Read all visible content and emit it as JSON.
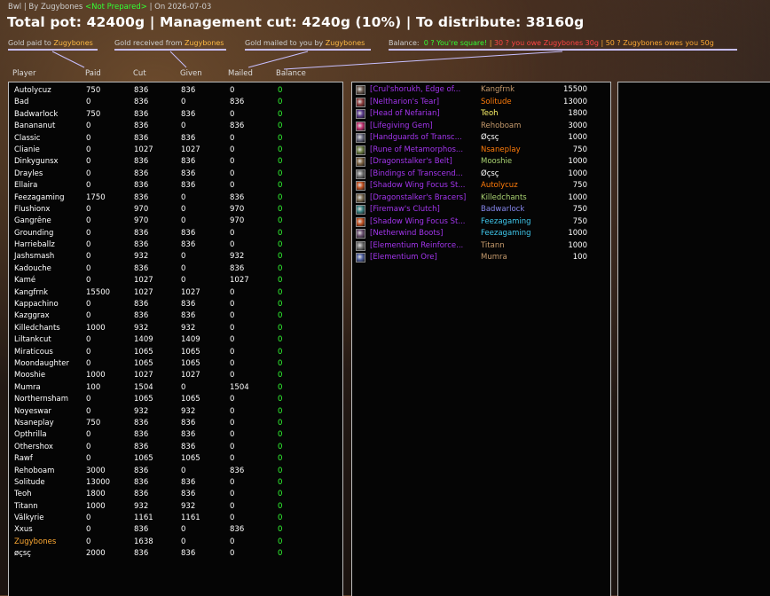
{
  "header": {
    "raid": "Bwl",
    "by": "| By Zugybones",
    "status": "<Not Prepared>",
    "date": "| On 2026-07-03",
    "title": "Total pot: 42400g | Management cut: 4240g (10%) | To distribute: 38160g"
  },
  "legend": {
    "paid_prefix": "Gold paid to",
    "received_prefix": "Gold received from",
    "mailed_prefix": "Gold mailed to you by",
    "name": "Zugybones",
    "balance_label": "Balance:",
    "square": "0 ? You're square!",
    "sep": "|",
    "owe": "30 ? you owe Zugybones 30g",
    "owes": "50 ? Zugybones owes you 50g"
  },
  "columns": [
    "Player",
    "Paid",
    "Cut",
    "Given",
    "Mailed",
    "Balance"
  ],
  "players": [
    {
      "name": "Autolycuz",
      "paid": "750",
      "cut": "836",
      "given": "836",
      "mailed": "0",
      "balance": "0"
    },
    {
      "name": "Bad",
      "paid": "0",
      "cut": "836",
      "given": "0",
      "mailed": "836",
      "balance": "0"
    },
    {
      "name": "Badwarlock",
      "paid": "750",
      "cut": "836",
      "given": "836",
      "mailed": "0",
      "balance": "0"
    },
    {
      "name": "Banananut",
      "paid": "0",
      "cut": "836",
      "given": "0",
      "mailed": "836",
      "balance": "0"
    },
    {
      "name": "Classic",
      "paid": "0",
      "cut": "836",
      "given": "836",
      "mailed": "0",
      "balance": "0"
    },
    {
      "name": "Clianie",
      "paid": "0",
      "cut": "1027",
      "given": "1027",
      "mailed": "0",
      "balance": "0"
    },
    {
      "name": "Dinkygunsx",
      "paid": "0",
      "cut": "836",
      "given": "836",
      "mailed": "0",
      "balance": "0"
    },
    {
      "name": "Drayles",
      "paid": "0",
      "cut": "836",
      "given": "836",
      "mailed": "0",
      "balance": "0"
    },
    {
      "name": "Ellaira",
      "paid": "0",
      "cut": "836",
      "given": "836",
      "mailed": "0",
      "balance": "0"
    },
    {
      "name": "Feezagaming",
      "paid": "1750",
      "cut": "836",
      "given": "0",
      "mailed": "836",
      "balance": "0"
    },
    {
      "name": "Flushionx",
      "paid": "0",
      "cut": "970",
      "given": "0",
      "mailed": "970",
      "balance": "0"
    },
    {
      "name": "Gangrêne",
      "paid": "0",
      "cut": "970",
      "given": "0",
      "mailed": "970",
      "balance": "0"
    },
    {
      "name": "Grounding",
      "paid": "0",
      "cut": "836",
      "given": "836",
      "mailed": "0",
      "balance": "0"
    },
    {
      "name": "Harrieballz",
      "paid": "0",
      "cut": "836",
      "given": "836",
      "mailed": "0",
      "balance": "0"
    },
    {
      "name": "Jashsmash",
      "paid": "0",
      "cut": "932",
      "given": "0",
      "mailed": "932",
      "balance": "0"
    },
    {
      "name": "Kadouche",
      "paid": "0",
      "cut": "836",
      "given": "0",
      "mailed": "836",
      "balance": "0"
    },
    {
      "name": "Kamé",
      "paid": "0",
      "cut": "1027",
      "given": "0",
      "mailed": "1027",
      "balance": "0"
    },
    {
      "name": "Kangfrnk",
      "paid": "15500",
      "cut": "1027",
      "given": "1027",
      "mailed": "0",
      "balance": "0"
    },
    {
      "name": "Kappachino",
      "paid": "0",
      "cut": "836",
      "given": "836",
      "mailed": "0",
      "balance": "0"
    },
    {
      "name": "Kazggrax",
      "paid": "0",
      "cut": "836",
      "given": "836",
      "mailed": "0",
      "balance": "0"
    },
    {
      "name": "Killedchants",
      "paid": "1000",
      "cut": "932",
      "given": "932",
      "mailed": "0",
      "balance": "0"
    },
    {
      "name": "Liltankcut",
      "paid": "0",
      "cut": "1409",
      "given": "1409",
      "mailed": "0",
      "balance": "0"
    },
    {
      "name": "Miraticous",
      "paid": "0",
      "cut": "1065",
      "given": "1065",
      "mailed": "0",
      "balance": "0"
    },
    {
      "name": "Moondaughter",
      "paid": "0",
      "cut": "1065",
      "given": "1065",
      "mailed": "0",
      "balance": "0"
    },
    {
      "name": "Mooshie",
      "paid": "1000",
      "cut": "1027",
      "given": "1027",
      "mailed": "0",
      "balance": "0"
    },
    {
      "name": "Mumra",
      "paid": "100",
      "cut": "1504",
      "given": "0",
      "mailed": "1504",
      "balance": "0"
    },
    {
      "name": "Northernsham",
      "paid": "0",
      "cut": "1065",
      "given": "1065",
      "mailed": "0",
      "balance": "0"
    },
    {
      "name": "Noyeswar",
      "paid": "0",
      "cut": "932",
      "given": "932",
      "mailed": "0",
      "balance": "0"
    },
    {
      "name": "Nsaneplay",
      "paid": "750",
      "cut": "836",
      "given": "836",
      "mailed": "0",
      "balance": "0"
    },
    {
      "name": "Opthrilla",
      "paid": "0",
      "cut": "836",
      "given": "836",
      "mailed": "0",
      "balance": "0"
    },
    {
      "name": "Othershox",
      "paid": "0",
      "cut": "836",
      "given": "836",
      "mailed": "0",
      "balance": "0"
    },
    {
      "name": "Rawf",
      "paid": "0",
      "cut": "1065",
      "given": "1065",
      "mailed": "0",
      "balance": "0"
    },
    {
      "name": "Rehoboam",
      "paid": "3000",
      "cut": "836",
      "given": "0",
      "mailed": "836",
      "balance": "0"
    },
    {
      "name": "Solitude",
      "paid": "13000",
      "cut": "836",
      "given": "836",
      "mailed": "0",
      "balance": "0"
    },
    {
      "name": "Teoh",
      "paid": "1800",
      "cut": "836",
      "given": "836",
      "mailed": "0",
      "balance": "0"
    },
    {
      "name": "Titann",
      "paid": "1000",
      "cut": "932",
      "given": "932",
      "mailed": "0",
      "balance": "0"
    },
    {
      "name": "Välkyrie",
      "paid": "0",
      "cut": "1161",
      "given": "1161",
      "mailed": "0",
      "balance": "0"
    },
    {
      "name": "Xxus",
      "paid": "0",
      "cut": "836",
      "given": "0",
      "mailed": "836",
      "balance": "0"
    },
    {
      "name": "Zugybones",
      "paid": "0",
      "cut": "1638",
      "given": "0",
      "mailed": "0",
      "balance": "0",
      "color": "#ffaa33"
    },
    {
      "name": "øçsç",
      "paid": "2000",
      "cut": "836",
      "given": "836",
      "mailed": "0",
      "balance": "0"
    }
  ],
  "items": [
    {
      "item": "[Crul'shorukh, Edge of...",
      "winner": "Kangfrnk",
      "amount": "15500",
      "winner_color": "#c69b6d",
      "icon": "axe-icon",
      "icon_color": "#6a5a50"
    },
    {
      "item": "[Neltharion's Tear]",
      "winner": "Solitude",
      "amount": "13000",
      "winner_color": "#ff7c0a",
      "icon": "gem-icon",
      "icon_color": "#8a3a3a"
    },
    {
      "item": "[Head of Nefarian]",
      "winner": "Teoh",
      "amount": "1800",
      "winner_color": "#fff468",
      "icon": "head-icon",
      "icon_color": "#5a3a8a"
    },
    {
      "item": "[Lifegiving Gem]",
      "winner": "Rehoboam",
      "amount": "3000",
      "winner_color": "#c69b6d",
      "icon": "orb-icon",
      "icon_color": "#c03070"
    },
    {
      "item": "[Handguards of Transc...",
      "winner": "Øçsç",
      "amount": "1000",
      "winner_color": "#ffffff",
      "icon": "gloves-icon",
      "icon_color": "#6a6a80"
    },
    {
      "item": "[Rune of Metamorphos...",
      "winner": "Nsaneplay",
      "amount": "750",
      "winner_color": "#ff7c0a",
      "icon": "rune-icon",
      "icon_color": "#6a7a40"
    },
    {
      "item": "[Dragonstalker's Belt]",
      "winner": "Mooshie",
      "amount": "1000",
      "winner_color": "#aad372",
      "icon": "belt-icon",
      "icon_color": "#7a6040"
    },
    {
      "item": "[Bindings of Transcend...",
      "winner": "Øçsç",
      "amount": "1000",
      "winner_color": "#ffffff",
      "icon": "bracers-icon",
      "icon_color": "#707070"
    },
    {
      "item": "[Shadow Wing Focus St...",
      "winner": "Autolycuz",
      "amount": "750",
      "winner_color": "#ff7c0a",
      "icon": "staff-icon",
      "icon_color": "#c05020"
    },
    {
      "item": "[Dragonstalker's Bracers]",
      "winner": "Killedchants",
      "amount": "1000",
      "winner_color": "#aad372",
      "icon": "bracers-icon",
      "icon_color": "#7a6a50"
    },
    {
      "item": "[Firemaw's Clutch]",
      "winner": "Badwarlock",
      "amount": "750",
      "winner_color": "#8788ee",
      "icon": "belt-icon",
      "icon_color": "#3a8080"
    },
    {
      "item": "[Shadow Wing Focus St...",
      "winner": "Feezagaming",
      "amount": "750",
      "winner_color": "#3fc7eb",
      "icon": "staff-icon",
      "icon_color": "#c05020"
    },
    {
      "item": "[Netherwind Boots]",
      "winner": "Feezagaming",
      "amount": "1000",
      "winner_color": "#3fc7eb",
      "icon": "boots-icon",
      "icon_color": "#6a5070"
    },
    {
      "item": "[Elementium Reinforce...",
      "winner": "Titann",
      "amount": "1000",
      "winner_color": "#c69b6d",
      "icon": "bar-icon",
      "icon_color": "#707070"
    },
    {
      "item": "[Elementium Ore]",
      "winner": "Mumra",
      "amount": "100",
      "winner_color": "#c69b6d",
      "icon": "ore-icon",
      "icon_color": "#5060a0"
    }
  ]
}
